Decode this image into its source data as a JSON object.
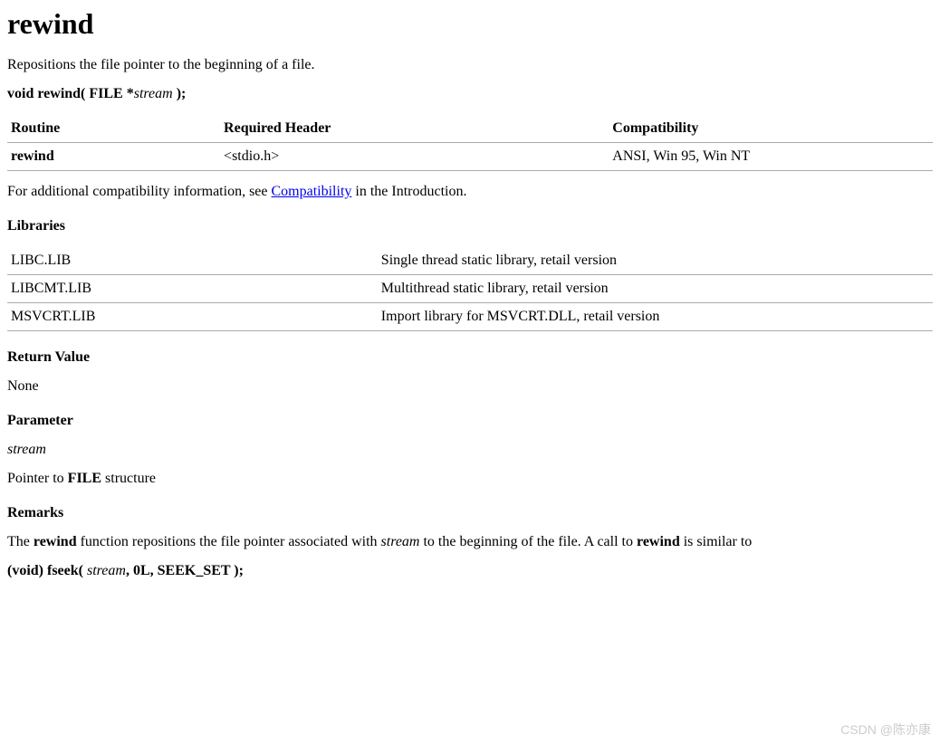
{
  "title": "rewind",
  "description": "Repositions the file pointer to the beginning of a file.",
  "signature": {
    "prefix": "void rewind( FILE *",
    "param": "stream",
    "suffix": " );"
  },
  "table1": {
    "headers": [
      "Routine",
      "Required Header",
      "Compatibility"
    ],
    "row": {
      "routine": "rewind",
      "header": "<stdio.h>",
      "compat": "ANSI, Win 95, Win NT"
    }
  },
  "compat_text": {
    "prefix": "For additional compatibility information, see ",
    "link": "Compatibility",
    "suffix": " in the Introduction."
  },
  "libraries_heading": "Libraries",
  "table2": [
    {
      "lib": "LIBC.LIB",
      "desc": "Single thread static library, retail version"
    },
    {
      "lib": "LIBCMT.LIB",
      "desc": "Multithread static library, retail version"
    },
    {
      "lib": "MSVCRT.LIB",
      "desc": "Import library for MSVCRT.DLL, retail version"
    }
  ],
  "return_heading": "Return Value",
  "return_value": "None",
  "parameter_heading": "Parameter",
  "parameter_name": "stream",
  "parameter_desc": {
    "prefix": "Pointer to ",
    "bold": "FILE",
    "suffix": " structure"
  },
  "remarks_heading": "Remarks",
  "remarks_text": {
    "t1": "The ",
    "b1": "rewind",
    "t2": " function repositions the file pointer associated with ",
    "i1": "stream",
    "t3": " to the beginning of the file. A call to ",
    "b2": "rewind",
    "t4": " is similar to"
  },
  "fseek_line": {
    "b1": "(void) fseek(",
    "sp1": " ",
    "i1": "stream",
    "b2": ", 0L, SEEK_SET );"
  },
  "watermark": "CSDN @陈亦康"
}
